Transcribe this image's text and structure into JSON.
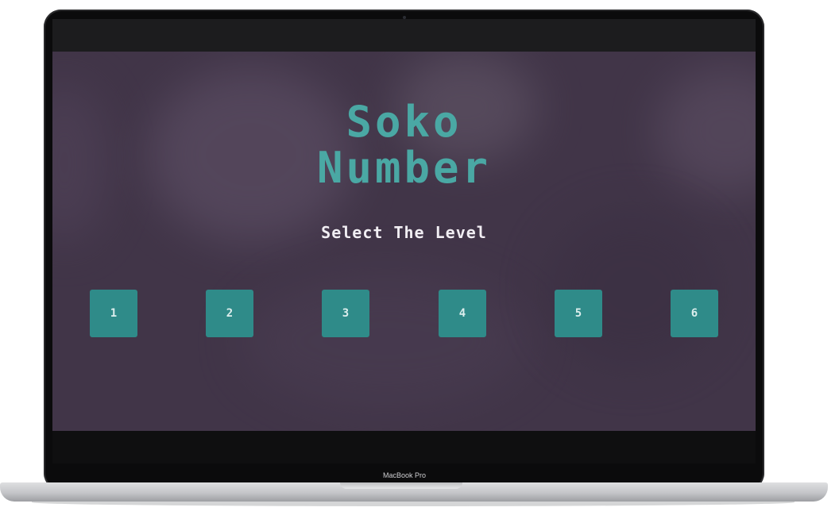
{
  "game": {
    "title_line1": "Soko",
    "title_line2": "Number",
    "subtitle": "Select The Level",
    "levels": [
      "1",
      "2",
      "3",
      "4",
      "5",
      "6"
    ],
    "colors": {
      "background": "#413548",
      "title": "#4aa8a4",
      "button": "#2f8b89",
      "subtitle": "#f1eef3"
    }
  },
  "device": {
    "label": "MacBook Pro"
  }
}
